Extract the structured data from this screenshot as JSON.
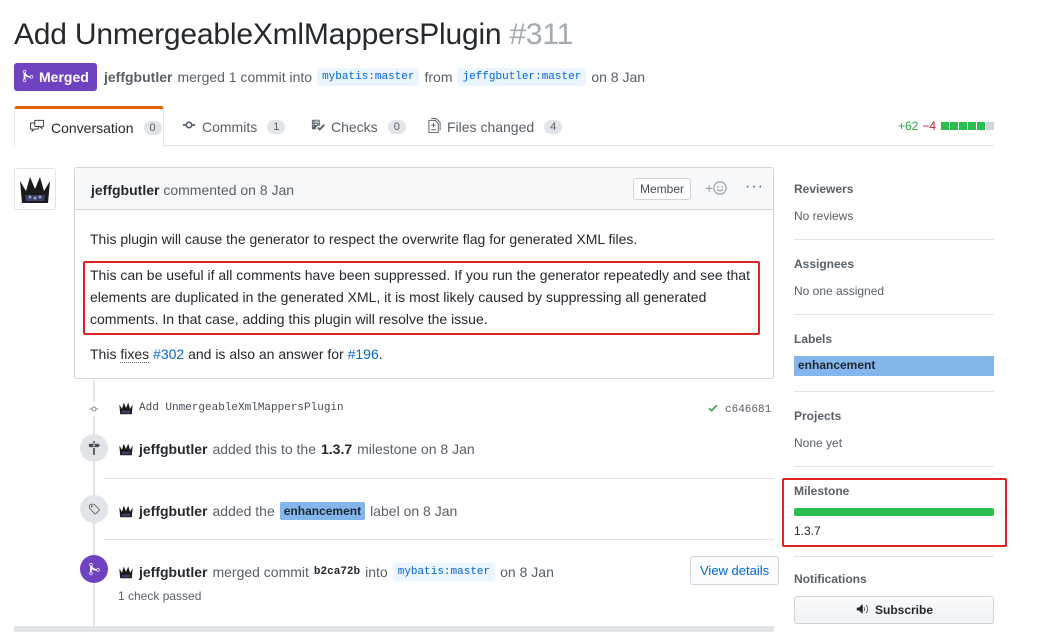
{
  "pr": {
    "title": "Add UnmergeableXmlMappersPlugin",
    "number": "#311",
    "state": "Merged",
    "author": "jeffgbutler",
    "merged_text": "merged 1 commit into",
    "base_branch": "mybatis:master",
    "from_text": "from",
    "head_branch": "jeffgbutler:master",
    "date_text": "on 8 Jan"
  },
  "tabs": [
    {
      "label": "Conversation",
      "count": "0",
      "icon": "comment-discussion-icon"
    },
    {
      "label": "Commits",
      "count": "1",
      "icon": "git-commit-icon"
    },
    {
      "label": "Checks",
      "count": "0",
      "icon": "checklist-icon"
    },
    {
      "label": "Files changed",
      "count": "4",
      "icon": "file-diff-icon"
    }
  ],
  "diffstat": {
    "additions": "+62",
    "deletions": "−4",
    "blocks": [
      "#2cbe4e",
      "#2cbe4e",
      "#2cbe4e",
      "#2cbe4e",
      "#2cbe4e",
      "#d1d5da"
    ]
  },
  "comment": {
    "author": "jeffgbutler",
    "action": "commented on 8 Jan",
    "badge": "Member",
    "para1": "This plugin will cause the generator to respect the overwrite flag for generated XML files.",
    "para2_line1": "This can be useful if all comments have been suppressed. If you run the generator repeatedly and see that",
    "para2_line2": "elements are duplicated in the generated XML, it is most likely caused by suppressing all generated",
    "para2_line3": "comments. In that case, adding this plugin will resolve the issue.",
    "para3_pre": "This",
    "para3_fixes": "fixes",
    "para3_ref1": "#302",
    "para3_mid": "and is also an answer for",
    "para3_ref2": "#196",
    "para3_end": "."
  },
  "timeline": {
    "commit": {
      "message": "Add UnmergeableXmlMappersPlugin",
      "sha": "c646681"
    },
    "milestone_event": {
      "author": "jeffgbutler",
      "pre": "added this to the",
      "milestone": "1.3.7",
      "post": "milestone on 8 Jan"
    },
    "label_event": {
      "author": "jeffgbutler",
      "pre": "added the",
      "label": "enhancement",
      "post": "label on 8 Jan"
    },
    "merge_event": {
      "author": "jeffgbutler",
      "pre": "merged commit",
      "sha": "b2ca72b",
      "mid": "into",
      "branch": "mybatis:master",
      "post": "on 8 Jan",
      "checks": "1 check passed",
      "button": "View details"
    }
  },
  "sidebar": {
    "reviewers": {
      "heading": "Reviewers",
      "value": "No reviews"
    },
    "assignees": {
      "heading": "Assignees",
      "value": "No one assigned"
    },
    "labels": {
      "heading": "Labels",
      "value": "enhancement"
    },
    "projects": {
      "heading": "Projects",
      "value": "None yet"
    },
    "milestone": {
      "heading": "Milestone",
      "value": "1.3.7",
      "progress": 1.0
    },
    "notifications": {
      "heading": "Notifications",
      "button": "Subscribe"
    }
  },
  "colors": {
    "merged": "#6f42c1",
    "label": "#84b6eb",
    "progress": "#2cbe4e",
    "highlight": "#e02222"
  }
}
